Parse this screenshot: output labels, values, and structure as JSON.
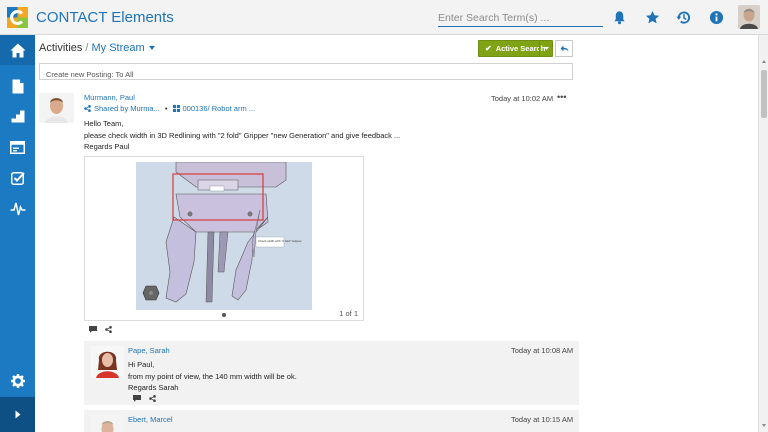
{
  "app": {
    "title": "CONTACT Elements",
    "search_placeholder": "Enter Search Term(s) ...",
    "accent": "#1f73b7",
    "sidebar_color": "#1b7ac2"
  },
  "topbar_icons": [
    "bell-icon",
    "star-icon",
    "history-icon",
    "info-icon"
  ],
  "sidebar": {
    "items": [
      "home-icon",
      "document-icon",
      "steps-icon",
      "card-icon",
      "task-icon",
      "activity-icon"
    ],
    "bottom": [
      "settings-icon",
      "expand-icon"
    ]
  },
  "header": {
    "crumb": "Activities",
    "separator": "/",
    "stream": "My Stream",
    "active_search": "Active Search",
    "new_posting_placeholder": "Create new Posting: To All"
  },
  "post": {
    "author": "Murmann, Paul",
    "shared": "Shared by Murma...",
    "separator": "•",
    "reference": "000136/ Robot arm ...",
    "time": "Today at 10:02 AM",
    "more": "•••",
    "lines": [
      "Hello Team,",
      "please check width in 3D Redlining with \"2 fold\" Gripper \"new Generation\" and give feedback ...",
      "Regards Paul"
    ],
    "image_label": "Check width with \"2 fold\" Gripper",
    "pager": "1 of 1"
  },
  "comments": [
    {
      "author": "Pape, Sarah",
      "time": "Today at 10:08 AM",
      "lines": [
        "Hi Paul,",
        "from my point of view, the 140 mm width will be ok.",
        "Regards Sarah"
      ]
    },
    {
      "author": "Ebert, Marcel",
      "time": "Today at 10:15 AM"
    }
  ]
}
